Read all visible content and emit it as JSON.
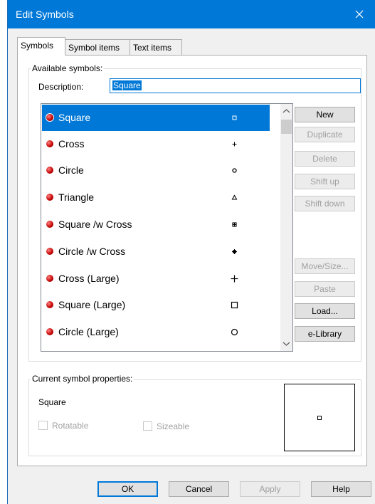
{
  "window": {
    "title": "Edit Symbols"
  },
  "tabs": [
    {
      "label": "Symbols",
      "active": true
    },
    {
      "label": "Symbol items",
      "active": false
    },
    {
      "label": "Text items",
      "active": false
    }
  ],
  "available_group": {
    "legend": "Available symbols:",
    "description_label": "Description:",
    "description_value": "Square"
  },
  "symbols": [
    {
      "label": "Square",
      "icon": "square-small-icon",
      "selected": true
    },
    {
      "label": "Cross",
      "icon": "cross-small-icon"
    },
    {
      "label": "Circle",
      "icon": "circle-small-icon"
    },
    {
      "label": "Triangle",
      "icon": "triangle-small-icon"
    },
    {
      "label": "Square /w Cross",
      "icon": "square-cross-small-icon"
    },
    {
      "label": "Circle /w Cross",
      "icon": "circle-cross-small-icon"
    },
    {
      "label": "Cross (Large)",
      "icon": "cross-large-icon"
    },
    {
      "label": "Square (Large)",
      "icon": "square-large-icon"
    },
    {
      "label": "Circle (Large)",
      "icon": "circle-large-icon"
    }
  ],
  "side_buttons": {
    "new": "New",
    "duplicate": "Duplicate",
    "delete": "Delete",
    "shift_up": "Shift up",
    "shift_down": "Shift down",
    "move_size": "Move/Size...",
    "paste": "Paste",
    "load": "Load...",
    "elibrary": "e-Library"
  },
  "properties_group": {
    "legend": "Current symbol properties:",
    "name": "Square",
    "rotatable_label": "Rotatable",
    "sizeable_label": "Sizeable"
  },
  "footer_buttons": {
    "ok": "OK",
    "cancel": "Cancel",
    "apply": "Apply",
    "help": "Help"
  },
  "colors": {
    "accent": "#0078d7",
    "disabled_text": "#a0a0a0"
  }
}
